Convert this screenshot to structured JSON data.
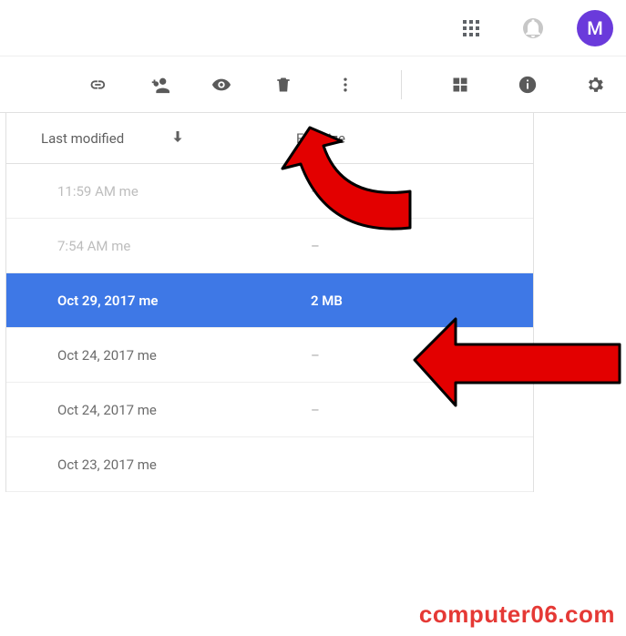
{
  "topbar": {
    "avatar_initial": "M"
  },
  "header": {
    "col_modified": "Last modified",
    "col_size": "File size"
  },
  "rows": [
    {
      "time": "11:59 AM",
      "owner": "me",
      "size": "–",
      "style": "dim"
    },
    {
      "time": "7:54 AM",
      "owner": "me",
      "size": "–",
      "style": "dim"
    },
    {
      "time": "Oct 29, 2017",
      "owner": "me",
      "size": "2 MB",
      "style": "selected"
    },
    {
      "time": "Oct 24, 2017",
      "owner": "me",
      "size": "–",
      "style": "normal"
    },
    {
      "time": "Oct 24, 2017",
      "owner": "me",
      "size": "–",
      "style": "normal"
    },
    {
      "time": "Oct 23, 2017",
      "owner": "me",
      "size": "",
      "style": "normal"
    }
  ],
  "watermark": "computer06.com"
}
